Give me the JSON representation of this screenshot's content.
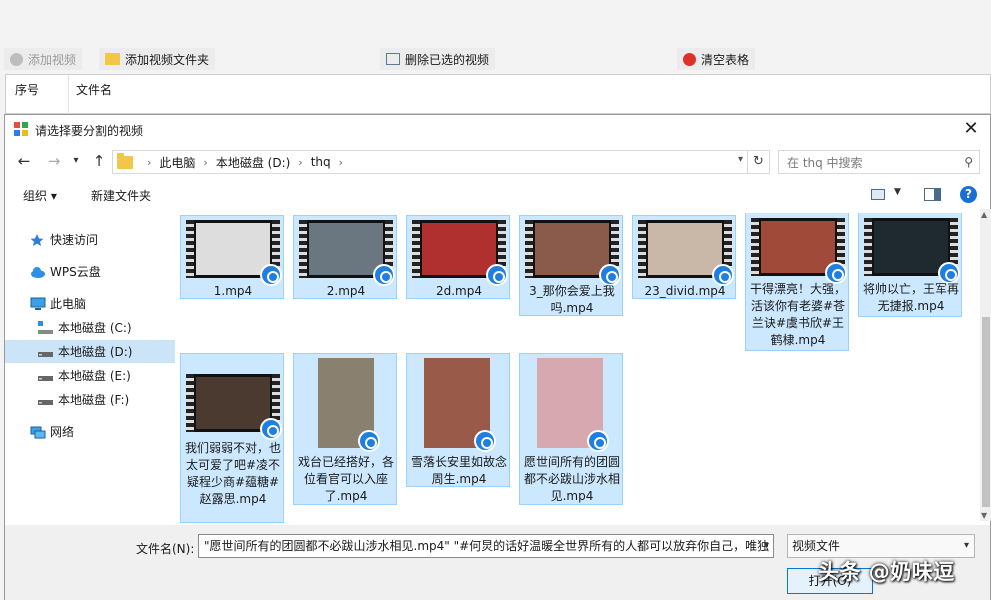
{
  "bg_app": {
    "toolbar": {
      "add_video": "添加视频",
      "add_folder": "添加视频文件夹",
      "delete_selected": "删除已选的视频",
      "clear_table": "清空表格"
    },
    "table": {
      "col_index": "序号",
      "col_filename": "文件名"
    }
  },
  "dialog": {
    "title": "请选择要分割的视频",
    "breadcrumb": [
      "此电脑",
      "本地磁盘 (D:)",
      "thq"
    ],
    "search_placeholder": "在 thq 中搜索",
    "cmd": {
      "organize": "组织 ▾",
      "new_folder": "新建文件夹"
    },
    "sidebar": [
      {
        "label": "快速访问",
        "icon": "star-icon"
      },
      {
        "label": "WPS云盘",
        "icon": "cloud-icon"
      },
      {
        "label": "此电脑",
        "icon": "computer-icon"
      },
      {
        "label": "本地磁盘 (C:)",
        "icon": "windows-drive-icon"
      },
      {
        "label": "本地磁盘 (D:)",
        "icon": "drive-icon",
        "selected": true
      },
      {
        "label": "本地磁盘 (E:)",
        "icon": "drive-icon"
      },
      {
        "label": "本地磁盘 (F:)",
        "icon": "drive-icon"
      },
      {
        "label": "网络",
        "icon": "network-icon"
      }
    ],
    "files": [
      {
        "name": "1.mp4",
        "frame_color": "#ddd"
      },
      {
        "name": "2.mp4",
        "frame_color": "#6a7680"
      },
      {
        "name": "2d.mp4",
        "frame_color": "#b03030"
      },
      {
        "name": "3_那你会爱上我吗.mp4",
        "frame_color": "#8a5a4a"
      },
      {
        "name": "23_divid.mp4",
        "frame_color": "#c9b8a8"
      },
      {
        "name": "干得漂亮！大强，活该你有老婆#苍兰诀#虞书欣#王鹤棣.mp4",
        "frame_color": "#a04a3a"
      },
      {
        "name": "将帅以亡，王军再无捷报.mp4",
        "frame_color": "#1e2a30"
      },
      {
        "name": "我们弱弱不对，也太可爱了吧#凌不疑程少商#蕴糖#赵露思.mp4",
        "frame_color": "#4a3a30"
      },
      {
        "name": "戏台已经搭好，各位看官可以入座了.mp4",
        "frame_color": "#8a8070"
      },
      {
        "name": "雪落长安里如故念周生.mp4",
        "frame_color": "#9a5a4a"
      },
      {
        "name": "愿世间所有的团圆都不必跋山涉水相见.mp4",
        "frame_color": "#d8a8b0"
      }
    ],
    "file_name_label": "文件名(N):",
    "file_name_value": "\"愿世间所有的团圆都不必跋山涉水相见.mp4\" \"#何炅的话好温暖全世界所有的人都可以放弃你自己，唯独",
    "file_type": "视频文件",
    "open_button": "打开(O)"
  },
  "watermark": "头条 @奶味逗"
}
